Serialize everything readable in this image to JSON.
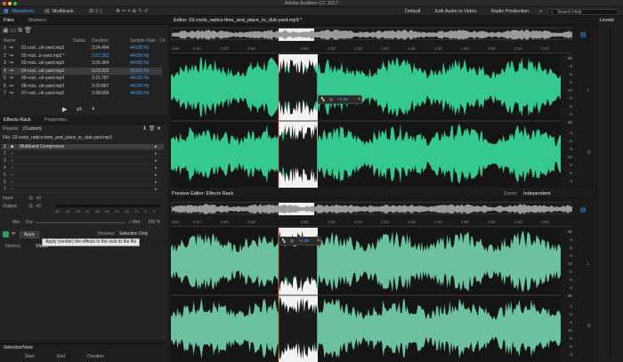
{
  "app": {
    "title": "Adobe Audition CC 2017",
    "colors": {
      "waveform": "#35c98f",
      "waveform_dim": "#6bc1a0",
      "accent": "#4aa3ff",
      "playhead": "#ff4c4c"
    }
  },
  "toolbar": {
    "waveform_tab": "Waveform",
    "multitrack_tab": "Multitrack",
    "workspaces": [
      "Default",
      "Edit Audio to Video",
      "Radio Production"
    ],
    "more": "»",
    "search_placeholder": "Search Help"
  },
  "files_panel": {
    "tabs": [
      "Files",
      "Markers"
    ],
    "columns": [
      "Name",
      "Status",
      "Duration",
      "Sample Rate",
      "Ch"
    ],
    "files": [
      {
        "name": "01-root...uh-yard.mp3",
        "duration": "3:24.494",
        "rate": "44100 Hz",
        "selected": false,
        "blue": false
      },
      {
        "name": "02-root...b-yard.mp3 *",
        "duration": "2:27.252",
        "rate": "44100 Hz",
        "selected": false,
        "blue": true
      },
      {
        "name": "03-root...uh-yard.mp3",
        "duration": "3:05.364",
        "rate": "44100 Hz",
        "selected": false,
        "blue": false
      },
      {
        "name": "04-root...uh-yard.mp3",
        "duration": "3:23.022",
        "rate": "44100 Hz",
        "selected": true,
        "blue": false
      },
      {
        "name": "05-root...uh-yard.mp3",
        "duration": "3:15.787",
        "rate": "44100 Hz",
        "selected": false,
        "blue": false
      },
      {
        "name": "06-root...uh-yard.mp3",
        "duration": "3:29.867",
        "rate": "44100 Hz",
        "selected": false,
        "blue": false
      },
      {
        "name": "07-root...uh-yard.mp3",
        "duration": "3:38.659",
        "rate": "44100 Hz",
        "selected": false,
        "blue": false
      }
    ]
  },
  "effects_rack": {
    "tabs": [
      "Effects Rack",
      "Properties"
    ],
    "presets_label": "Presets:",
    "presets_value": "(Custom)",
    "file_label": "File: 02-roots_radics-time_and_place_to_dub-yard.mp3",
    "slots": [
      {
        "num": "1",
        "name": "Multiband Compressor",
        "selected": true
      },
      {
        "num": "2",
        "name": "",
        "selected": false
      },
      {
        "num": "3",
        "name": "",
        "selected": false
      },
      {
        "num": "4",
        "name": "",
        "selected": false
      },
      {
        "num": "5",
        "name": "",
        "selected": false
      },
      {
        "num": "6",
        "name": "",
        "selected": false
      },
      {
        "num": "7",
        "name": "",
        "selected": false
      }
    ],
    "input_label": "Input:",
    "input_value": "+0",
    "output_label": "Output:",
    "output_value": "+0",
    "meter_scale": [
      "dB",
      "-54",
      "-48",
      "-42",
      "-36",
      "-30",
      "-24",
      "-18",
      "-12",
      "-6",
      "0"
    ],
    "mix_label": "Mix:",
    "dry_label": "Dry",
    "wet_label": "Wet",
    "mix_value": "100 %",
    "apply_label": "Apply",
    "process_label": "Process:",
    "process_value": "Selection Only",
    "tooltip": "Apply (render) the effects in the rack to the file"
  },
  "history": {
    "tabs": [
      "History",
      "Video"
    ]
  },
  "selection_view": {
    "title": "Selection/View",
    "columns": [
      "Start",
      "End",
      "Duration"
    ]
  },
  "editor": {
    "title": "Editor: 02-roots_radics-time_and_place_to_dub-yard.mp3 *",
    "ruler_ticks": [
      "hms",
      "0:10",
      "0:20",
      "0:30",
      "0:50",
      "1:00",
      "1:10",
      "1:20",
      "1:30",
      "1:40",
      "1:50",
      "2:00",
      "2:10",
      "2:20"
    ],
    "hud_value": "+0 dB",
    "db_scale": [
      "dB",
      "-3",
      "-6",
      "-9",
      "-15",
      "-9",
      "-6",
      "-3",
      "dB",
      "-3",
      "-6",
      "-9",
      "-15",
      "-9",
      "-6",
      "-3"
    ],
    "channel_labels": [
      "L",
      "R"
    ]
  },
  "preview": {
    "title": "Preview Editor: Effects Rack",
    "zoom_label": "Zoom:",
    "zoom_value": "Independent",
    "ruler_ticks": [
      "hms",
      "0:10",
      "0:20",
      "0:30",
      "0:50",
      "1:00",
      "1:10",
      "1:20",
      "1:30",
      "1:40",
      "1:50",
      "2:00",
      "2:10",
      "2:20"
    ],
    "hud_value": "+0 dB",
    "db_scale": [
      "dB",
      "-3",
      "-6",
      "-9",
      "-15",
      "-9",
      "-6",
      "-3",
      "dB",
      "-3",
      "-6",
      "-9",
      "-15",
      "-9",
      "-6",
      "-3"
    ],
    "channel_labels": [
      "L",
      "R"
    ]
  },
  "levels": {
    "title": "Levels"
  }
}
